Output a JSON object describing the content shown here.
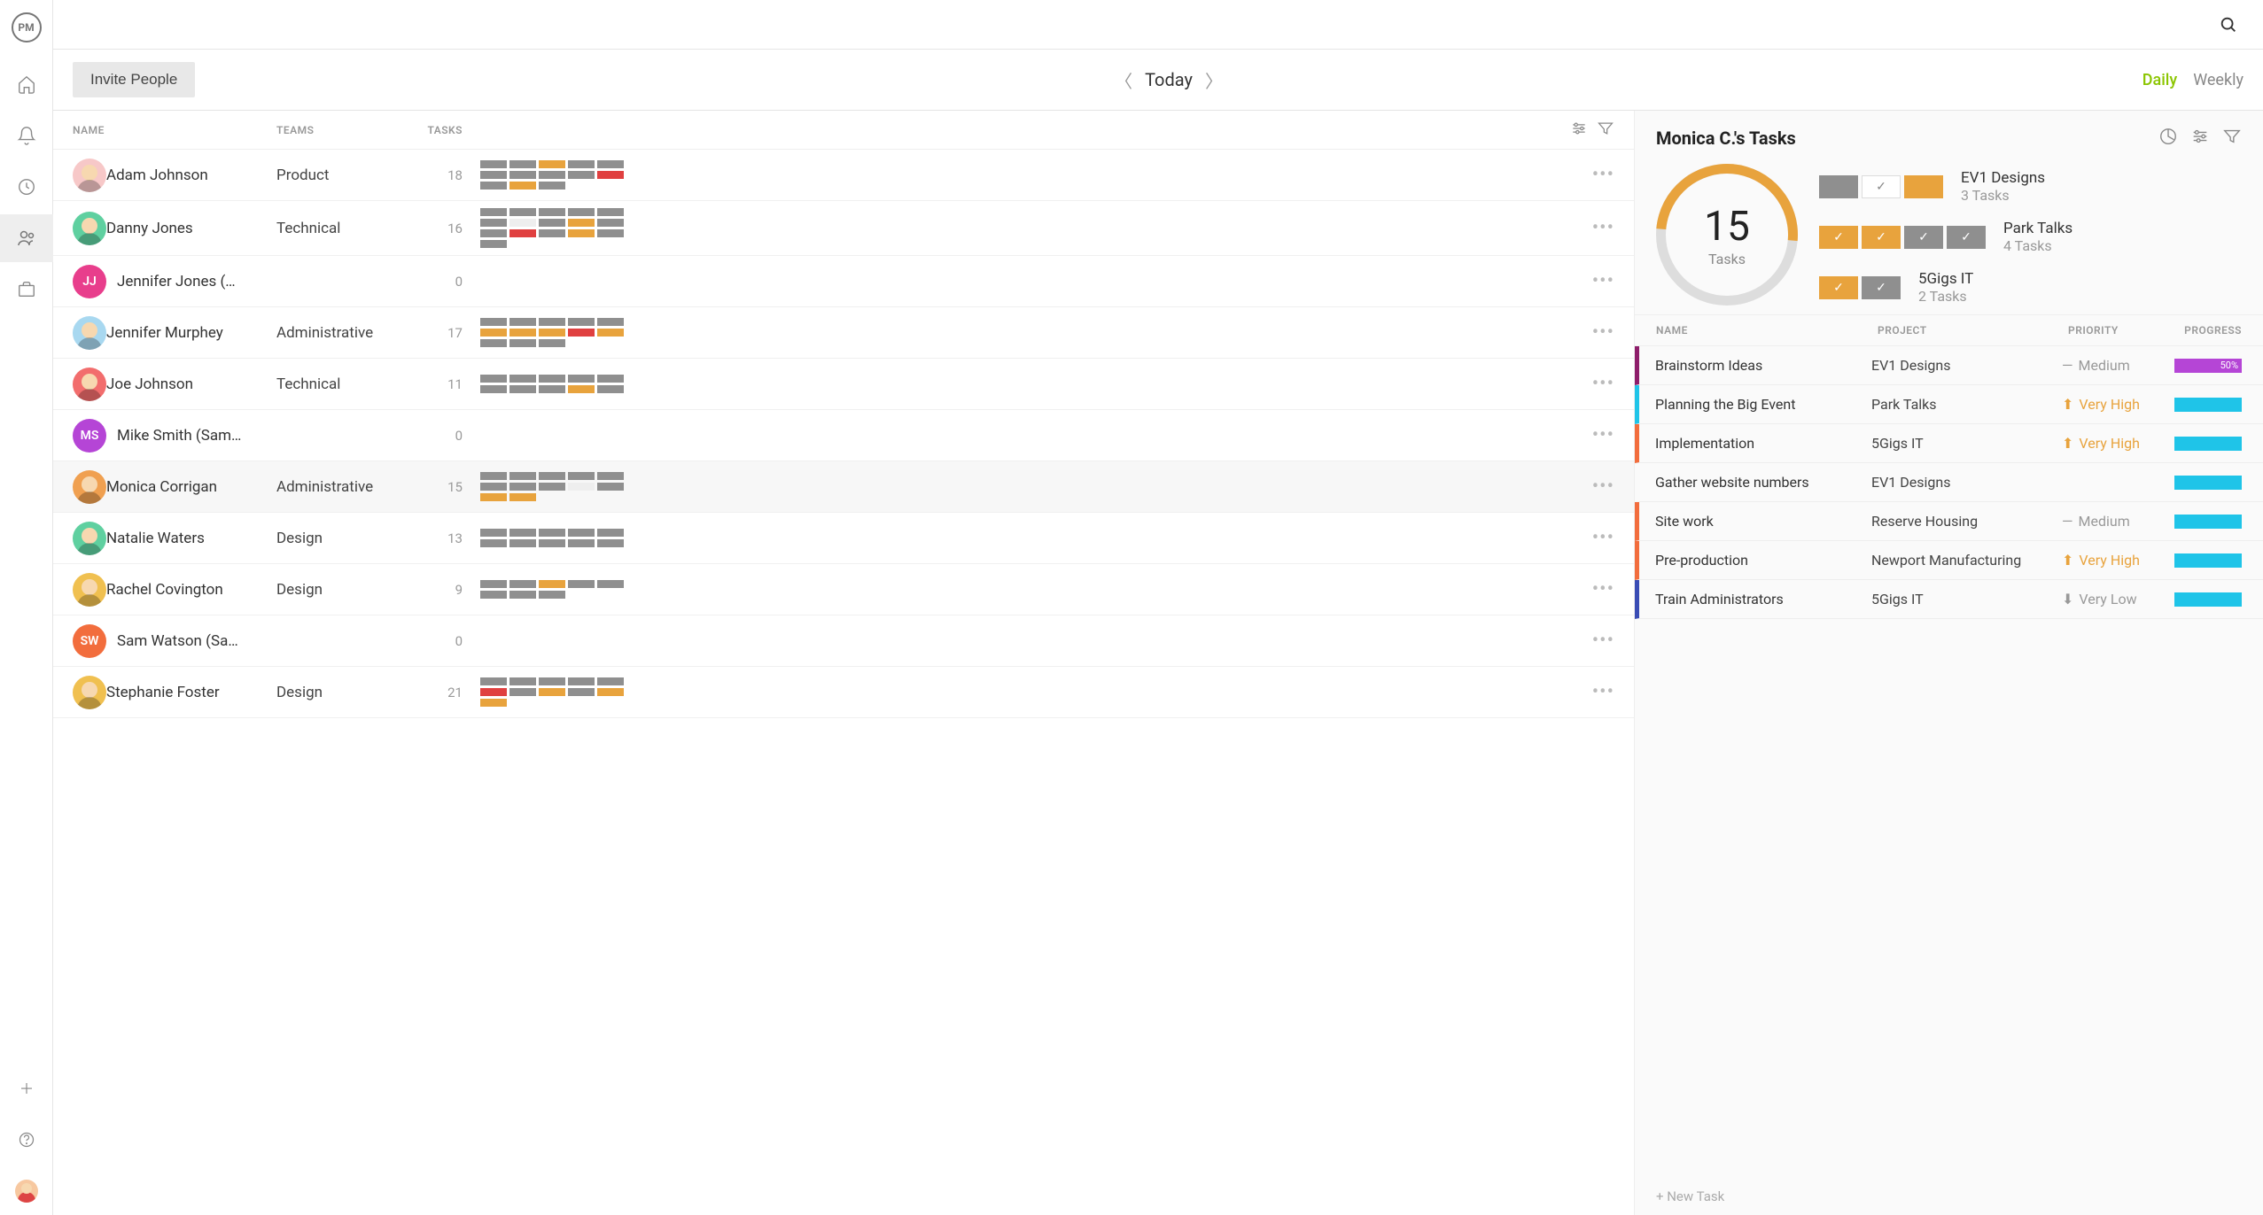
{
  "logo": "PM",
  "toolbar": {
    "invite": "Invite People",
    "today": "Today",
    "daily": "Daily",
    "weekly": "Weekly"
  },
  "columns": {
    "name": "NAME",
    "teams": "TEAMS",
    "tasks": "TASKS"
  },
  "people": [
    {
      "name": "Adam Johnson",
      "team": "Product",
      "tasks": 18,
      "avatar_bg": "#f7c8c8",
      "initials": "",
      "face": true,
      "blocks": [
        "g",
        "g",
        "o",
        "g",
        "g",
        "g",
        "g",
        "g",
        "g",
        "r",
        "g",
        "o",
        "g"
      ]
    },
    {
      "name": "Danny Jones",
      "team": "Technical",
      "tasks": 16,
      "avatar_bg": "#5fd0a0",
      "initials": "",
      "face": true,
      "blocks": [
        "g",
        "g",
        "g",
        "g",
        "g",
        "g",
        "w",
        "g",
        "o",
        "g",
        "g",
        "r",
        "g",
        "o",
        "g",
        "g"
      ]
    },
    {
      "name": "Jennifer Jones (…",
      "team": "",
      "tasks": 0,
      "avatar_bg": "#e83e8c",
      "initials": "JJ",
      "face": false,
      "blocks": []
    },
    {
      "name": "Jennifer Murphey",
      "team": "Administrative",
      "tasks": 17,
      "avatar_bg": "#a8d8f0",
      "initials": "",
      "face": true,
      "blocks": [
        "g",
        "g",
        "g",
        "g",
        "g",
        "o",
        "o",
        "o",
        "r",
        "o",
        "g",
        "g",
        "g"
      ]
    },
    {
      "name": "Joe Johnson",
      "team": "Technical",
      "tasks": 11,
      "avatar_bg": "#f26d6d",
      "initials": "",
      "face": true,
      "blocks": [
        "g",
        "g",
        "g",
        "g",
        "g",
        "g",
        "g",
        "g",
        "o",
        "g"
      ]
    },
    {
      "name": "Mike Smith (Sam…",
      "team": "",
      "tasks": 0,
      "avatar_bg": "#b545d6",
      "initials": "MS",
      "face": false,
      "blocks": []
    },
    {
      "name": "Monica Corrigan",
      "team": "Administrative",
      "tasks": 15,
      "avatar_bg": "#f0a050",
      "initials": "",
      "face": true,
      "blocks": [
        "g",
        "g",
        "g",
        "g",
        "g",
        "g",
        "g",
        "g",
        "w",
        "g",
        "o",
        "o"
      ],
      "selected": true
    },
    {
      "name": "Natalie Waters",
      "team": "Design",
      "tasks": 13,
      "avatar_bg": "#5fd0a0",
      "initials": "",
      "face": true,
      "blocks": [
        "g",
        "g",
        "g",
        "g",
        "g",
        "g",
        "g",
        "g",
        "g",
        "g"
      ]
    },
    {
      "name": "Rachel Covington",
      "team": "Design",
      "tasks": 9,
      "avatar_bg": "#f0c050",
      "initials": "",
      "face": true,
      "blocks": [
        "g",
        "g",
        "o",
        "g",
        "g",
        "g",
        "g",
        "g"
      ]
    },
    {
      "name": "Sam Watson (Sa…",
      "team": "",
      "tasks": 0,
      "avatar_bg": "#f26d3d",
      "initials": "SW",
      "face": false,
      "blocks": []
    },
    {
      "name": "Stephanie Foster",
      "team": "Design",
      "tasks": 21,
      "avatar_bg": "#f0c050",
      "initials": "",
      "face": true,
      "blocks": [
        "g",
        "g",
        "g",
        "g",
        "g",
        "r",
        "g",
        "o",
        "g",
        "o",
        "o"
      ]
    }
  ],
  "detail": {
    "title": "Monica C.'s Tasks",
    "ring": {
      "count": "15",
      "label": "Tasks"
    },
    "projects": [
      {
        "name": "EV1 Designs",
        "count": "3 Tasks",
        "chips": [
          {
            "c": "gray",
            "chk": false
          },
          {
            "c": "white",
            "chk": true
          },
          {
            "c": "orange",
            "chk": false
          }
        ]
      },
      {
        "name": "Park Talks",
        "count": "4 Tasks",
        "chips": [
          {
            "c": "orange",
            "chk": true
          },
          {
            "c": "orange",
            "chk": true
          },
          {
            "c": "gray",
            "chk": true
          },
          {
            "c": "gray",
            "chk": true
          }
        ]
      },
      {
        "name": "5Gigs IT",
        "count": "2 Tasks",
        "chips": [
          {
            "c": "orange",
            "chk": true
          },
          {
            "c": "gray",
            "chk": true
          }
        ]
      }
    ],
    "task_columns": {
      "name": "NAME",
      "project": "PROJECT",
      "priority": "PRIORITY",
      "progress": "PROGRESS"
    },
    "tasks": [
      {
        "name": "Brainstorm Ideas",
        "project": "EV1 Designs",
        "priority": "Medium",
        "pri_type": "med",
        "border": "#8e1e6b",
        "bar": "purple",
        "pct": "50%"
      },
      {
        "name": "Planning the Big Event",
        "project": "Park Talks",
        "priority": "Very High",
        "pri_type": "high",
        "border": "#1fc4e8",
        "bar": "cyan",
        "pct": ""
      },
      {
        "name": "Implementation",
        "project": "5Gigs IT",
        "priority": "Very High",
        "pri_type": "high",
        "border": "#f26d3d",
        "bar": "cyan",
        "pct": ""
      },
      {
        "name": "Gather website numbers",
        "project": "EV1 Designs",
        "priority": "",
        "pri_type": "",
        "border": "transparent",
        "bar": "cyan",
        "pct": ""
      },
      {
        "name": "Site work",
        "project": "Reserve Housing",
        "priority": "Medium",
        "pri_type": "med",
        "border": "#f26d3d",
        "bar": "cyan",
        "pct": ""
      },
      {
        "name": "Pre-production",
        "project": "Newport Manufacturing",
        "priority": "Very High",
        "pri_type": "high",
        "border": "#f26d3d",
        "bar": "cyan",
        "pct": ""
      },
      {
        "name": "Train Administrators",
        "project": "5Gigs IT",
        "priority": "Very Low",
        "pri_type": "low",
        "border": "#3a4db5",
        "bar": "cyan",
        "pct": ""
      }
    ],
    "new_task": "+  New Task"
  }
}
